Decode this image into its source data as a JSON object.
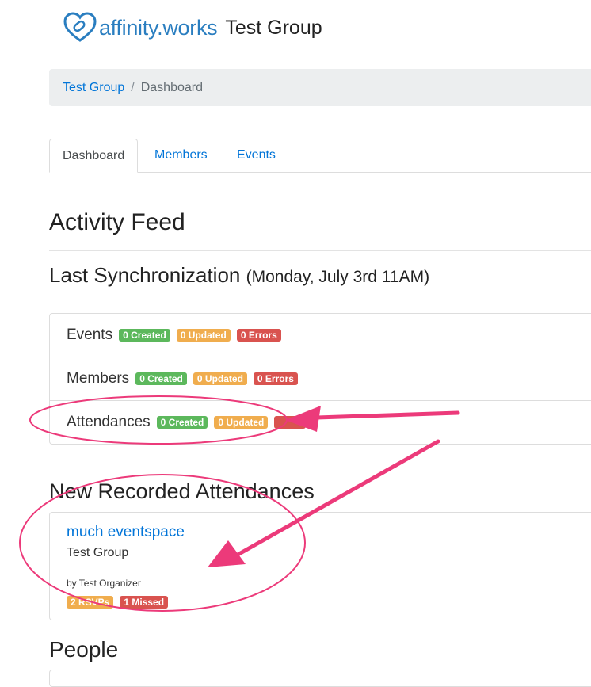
{
  "header": {
    "brand": "affinity.works",
    "group_name": "Test Group"
  },
  "breadcrumb": {
    "group": "Test Group",
    "current": "Dashboard"
  },
  "tabs": [
    {
      "label": "Dashboard",
      "active": true
    },
    {
      "label": "Members",
      "active": false
    },
    {
      "label": "Events",
      "active": false
    }
  ],
  "activity_feed": {
    "title": "Activity Feed",
    "sync_title": "Last Synchronization",
    "sync_time": "(Monday, July 3rd 11AM)"
  },
  "sync_rows": [
    {
      "label": "Events",
      "created": "0 Created",
      "updated": "0 Updated",
      "errors": "0 Errors"
    },
    {
      "label": "Members",
      "created": "0 Created",
      "updated": "0 Updated",
      "errors": "0 Errors"
    },
    {
      "label": "Attendances",
      "created": "0 Created",
      "updated": "0 Updated"
    }
  ],
  "new_attendances": {
    "title": "New Recorded Attendances",
    "event_name": "much eventspace",
    "group": "Test Group",
    "organizer": "by Test Organizer",
    "rsvps": "2 RSVPs",
    "missed": "1 Missed"
  },
  "people": {
    "title": "People"
  },
  "colors": {
    "link": "#0275d8",
    "brand": "#2a7ec0",
    "badge_green": "#5cb85c",
    "badge_orange": "#f0ad4e",
    "badge_red": "#d9534f",
    "annotation": "#ec3a7a"
  }
}
